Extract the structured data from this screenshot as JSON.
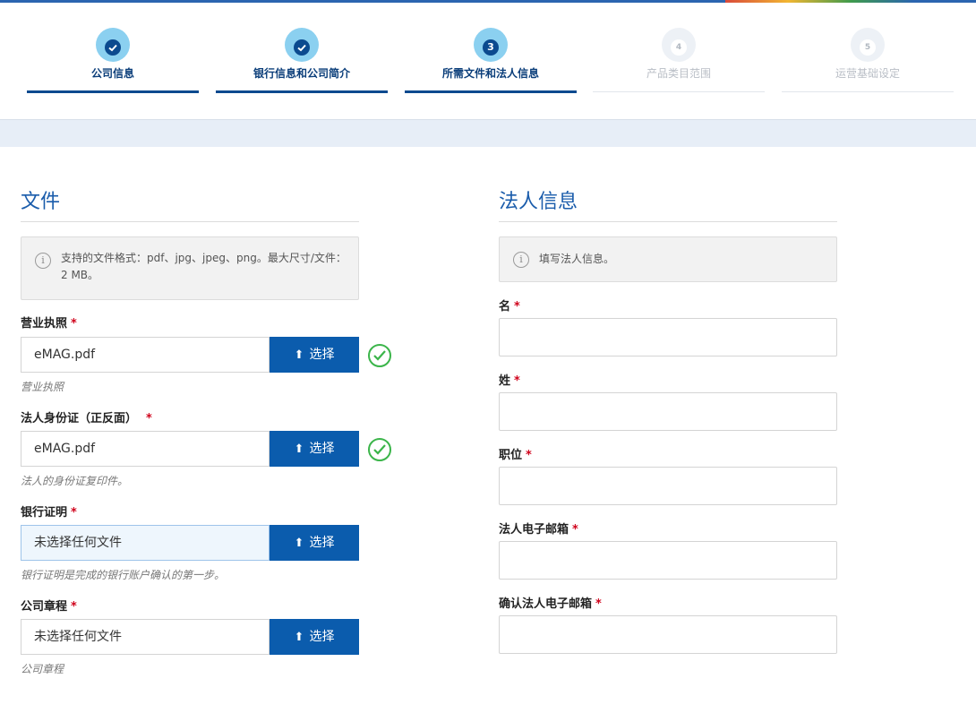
{
  "steps": [
    {
      "label": "公司信息",
      "state": "done",
      "num": "✓"
    },
    {
      "label": "银行信息和公司简介",
      "state": "done",
      "num": "✓"
    },
    {
      "label": "所需文件和法人信息",
      "state": "current",
      "num": "3"
    },
    {
      "label": "产品类目范围",
      "state": "inactive",
      "num": "4"
    },
    {
      "label": "运营基础设定",
      "state": "inactive",
      "num": "5"
    }
  ],
  "files": {
    "title": "文件",
    "info": "支持的文件格式：pdf、jpg、jpeg、png。最大尺寸/文件：2 MB。",
    "choose_label": "选择",
    "items": [
      {
        "label": "营业执照",
        "value": "eMAG.pdf",
        "hint": "营业执照",
        "uploaded": true
      },
      {
        "label": "法人身份证（正反面）",
        "value": "eMAG.pdf",
        "hint": "法人的身份证复印件。",
        "uploaded": true
      },
      {
        "label": "银行证明",
        "value": "未选择任何文件",
        "hint": "银行证明是完成的银行账户确认的第一步。",
        "uploaded": false
      },
      {
        "label": "公司章程",
        "value": "未选择任何文件",
        "hint": "公司章程",
        "uploaded": false
      }
    ]
  },
  "legal": {
    "title": "法人信息",
    "info": "填写法人信息。",
    "fields": [
      {
        "label": "名",
        "value": ""
      },
      {
        "label": "姓",
        "value": ""
      },
      {
        "label": "职位",
        "value": ""
      },
      {
        "label": "法人电子邮箱",
        "value": ""
      },
      {
        "label": "确认法人电子邮箱",
        "value": ""
      }
    ]
  },
  "required_mark": "*",
  "colors": {
    "brand": "#0b5cad",
    "heading": "#1a5cab",
    "success": "#3bb54a",
    "required": "#d0021b"
  }
}
